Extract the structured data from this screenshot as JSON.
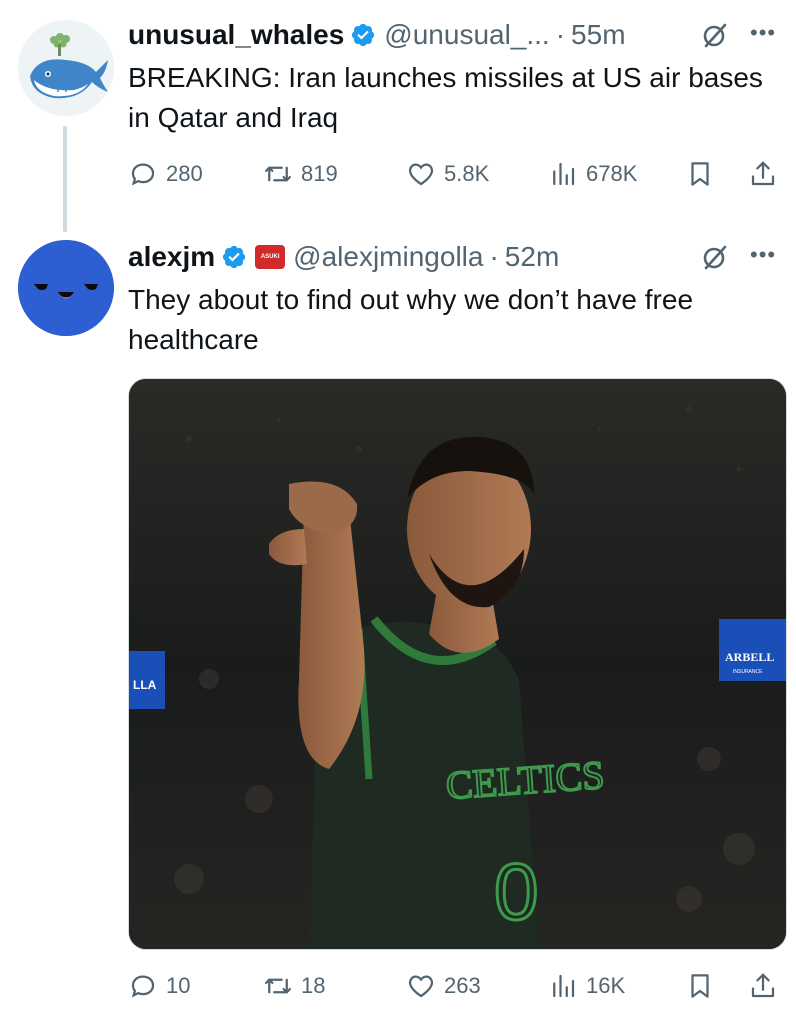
{
  "tweets": [
    {
      "display_name": "unusual_whales",
      "handle": "@unusual_...",
      "separator": "·",
      "time": "55m",
      "text": "BREAKING: Iran launches missiles at US air bases in Qatar and Iraq",
      "replies": "280",
      "reposts": "819",
      "likes": "5.8K",
      "views": "678K",
      "avatar_icon": "whale-logo-icon"
    },
    {
      "display_name": "alexjm",
      "handle": "@alexjmingolla",
      "separator": "·",
      "time": "52m",
      "affiliate_badge": "ASUKI",
      "text": "They about to find out why we don’t have free healthcare",
      "replies": "10",
      "reposts": "18",
      "likes": "263",
      "views": "16K",
      "avatar_icon": "smiley-face-icon",
      "media": {
        "jersey_text": "CELTICS",
        "jersey_number": "0",
        "arena_sign": "ARBELL",
        "arena_sign_sub": "INSURANCE",
        "arena_sign_left": "LLA"
      }
    }
  ],
  "colors": {
    "verified": "#1d9bf0",
    "muted": "#536471",
    "text": "#0f1419",
    "avatar_blue": "#2d5fd3"
  }
}
